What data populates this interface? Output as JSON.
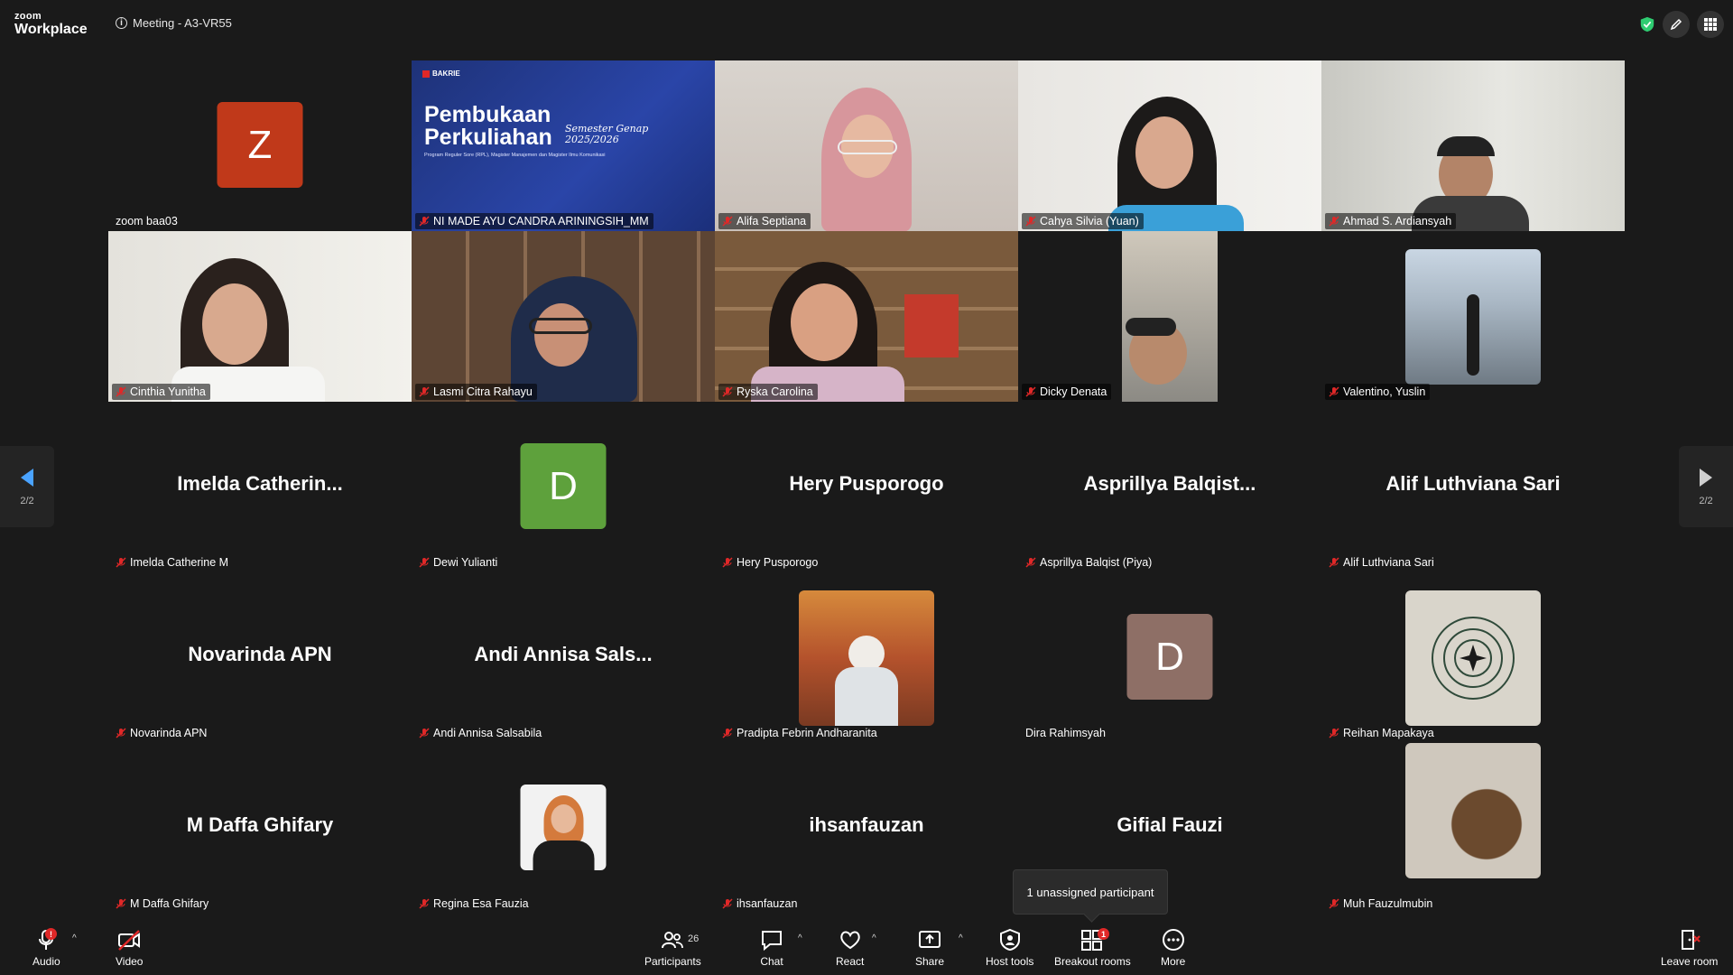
{
  "app": {
    "logo_small": "zoom",
    "logo_large": "Workplace",
    "meeting_title": "Meeting - A3-VR55"
  },
  "colors": {
    "accent_green": "#2ecc71",
    "avatar_z": "#c0391a",
    "avatar_d_green": "#5ea13c",
    "avatar_d_brown": "#8e6f66",
    "muted_red": "#e02828"
  },
  "slide": {
    "brand": "BAKRIE",
    "title_line1": "Pembukaan",
    "title_line2": "Perkuliahan",
    "semester": "Semester Genap",
    "year": "2025/2026",
    "subtitle": "Program Reguler Sore (RPL), Magister Manajemen dan Magister Ilmu Komunikasi"
  },
  "tiles": [
    {
      "name": "zoom baa03",
      "avatar": "Z",
      "muted": false
    },
    {
      "name": "NI MADE AYU CANDRA ARININGSIH_MM",
      "muted": true
    },
    {
      "name": "Alifa Septiana",
      "muted": true
    },
    {
      "name": "Cahya Silvia (Yuan)",
      "muted": true
    },
    {
      "name": "Ahmad S. Ardiansyah",
      "muted": true
    },
    {
      "name": "Cinthia Yunitha",
      "muted": true
    },
    {
      "name": "Lasmi Citra Rahayu",
      "muted": true
    },
    {
      "name": "Ryska Carolina",
      "muted": true
    },
    {
      "name": "Dicky Denata",
      "muted": true
    },
    {
      "name": "Valentino, Yuslin",
      "muted": true
    },
    {
      "name": "Imelda Catherine M",
      "display": "Imelda  Catherin...",
      "muted": true
    },
    {
      "name": "Dewi Yulianti",
      "avatar": "D",
      "muted": true
    },
    {
      "name": "Hery Pusporogo",
      "display": "Hery Pusporogo",
      "muted": true
    },
    {
      "name": "Asprillya Balqist (Piya)",
      "display": "Asprillya  Balqist...",
      "muted": true
    },
    {
      "name": "Alif Luthviana Sari",
      "display": "Alif Luthviana Sari",
      "muted": true
    },
    {
      "name": "Novarinda APN",
      "display": "Novarinda APN",
      "muted": true
    },
    {
      "name": "Andi Annisa Salsabila",
      "display": "Andi  Annisa  Sals...",
      "muted": true
    },
    {
      "name": "Pradipta Febrin Andharanita",
      "muted": true
    },
    {
      "name": "Dira Rahimsyah",
      "avatar": "D",
      "muted": false
    },
    {
      "name": "Reihan Mapakaya",
      "muted": true
    },
    {
      "name": "M Daffa Ghifary",
      "display": "M Daffa Ghifary",
      "muted": true
    },
    {
      "name": "Regina Esa Fauzia",
      "muted": true
    },
    {
      "name": "ihsanfauzan",
      "display": "ihsanfauzan",
      "muted": true
    },
    {
      "name": "",
      "display": "Gifial Fauzi",
      "muted": false
    },
    {
      "name": "Muh Fauzulmubin",
      "muted": true
    }
  ],
  "pager": {
    "left": "2/2",
    "right": "2/2"
  },
  "tooltip": "1 unassigned participant",
  "toolbar": {
    "audio": "Audio",
    "audio_badge": "!",
    "video": "Video",
    "participants": "Participants",
    "participants_count": "26",
    "chat": "Chat",
    "react": "React",
    "share": "Share",
    "host_tools": "Host tools",
    "breakout": "Breakout rooms",
    "breakout_badge": "1",
    "more": "More",
    "leave": "Leave room"
  }
}
